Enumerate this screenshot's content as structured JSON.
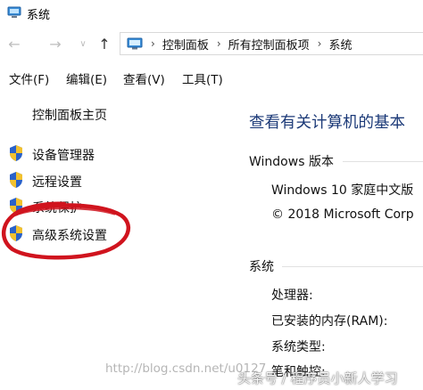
{
  "window": {
    "title": "系统"
  },
  "nav": {
    "back_glyph": "←",
    "forward_glyph": "→",
    "recent_glyph": "∨",
    "up_glyph": "↑"
  },
  "breadcrumb": {
    "separator": "›",
    "items": [
      "控制面板",
      "所有控制面板项",
      "系统"
    ]
  },
  "menubar": {
    "items": [
      "文件(F)",
      "编辑(E)",
      "查看(V)",
      "工具(T)"
    ]
  },
  "sidebar": {
    "home_label": "控制面板主页",
    "items": [
      {
        "label": "设备管理器",
        "icon": "shield-icon"
      },
      {
        "label": "远程设置",
        "icon": "shield-icon"
      },
      {
        "label": "系统保护",
        "icon": "shield-icon"
      },
      {
        "label": "高级系统设置",
        "icon": "shield-icon"
      }
    ]
  },
  "main": {
    "heading": "查看有关计算机的基本",
    "windows_edition": {
      "label": "Windows 版本",
      "edition": "Windows 10 家庭中文版",
      "copyright": "© 2018 Microsoft Corp"
    },
    "system": {
      "label": "系统",
      "rows": [
        "处理器:",
        "已安装的内存(RAM):",
        "系统类型:",
        "笔和触控:"
      ]
    }
  },
  "watermarks": {
    "url": "http://blog.csdn.net/u0127",
    "author": "头条号 / 程序员小新人学习"
  },
  "colors": {
    "heading": "#1c3a78",
    "annotation": "#d0141e",
    "shield_blue": "#2a62c9",
    "shield_yellow": "#f2c12e"
  }
}
